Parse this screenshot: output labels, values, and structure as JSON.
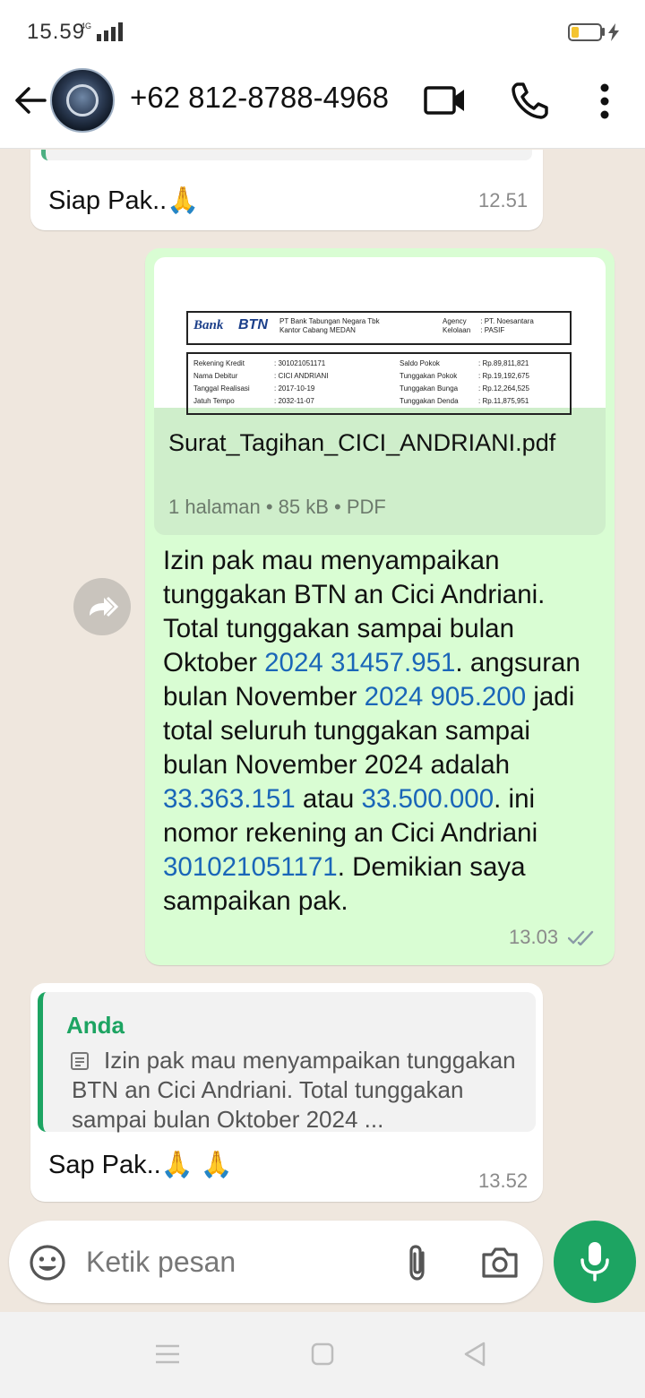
{
  "status_bar": {
    "time": "15.59",
    "network": "4G",
    "battery_level": 0.25,
    "charging": true
  },
  "header": {
    "contact": "+62 812-8788-4968",
    "icons": [
      "back-arrow-icon",
      "avatar",
      "video-call-icon",
      "phone-icon",
      "more-vert-icon"
    ]
  },
  "messages": [
    {
      "direction": "incoming",
      "text": "Siap Pak..🙏",
      "time": "12.51"
    },
    {
      "direction": "outgoing",
      "document": {
        "name": "Surat_Tagihan_CICI_ANDRIANI.pdf",
        "meta": "1 halaman • 85 kB • PDF",
        "preview": {
          "bank": "Bank",
          "brand": "BTN",
          "bank_name": "PT Bank Tabungan Negara Tbk",
          "branch": "Kantor Cabang MEDAN",
          "agency_label": "Agency",
          "agency_value": ": PT. Noesantara",
          "kelolaan_label": "Kelolaan",
          "kelolaan_value": ": PASIF",
          "rows_left": [
            [
              "Rekening Kredit",
              ": 301021051171"
            ],
            [
              "Nama Debitur",
              ": CICI ANDRIANI"
            ],
            [
              "Tanggal Realisasi",
              ": 2017-10-19"
            ],
            [
              "Jatuh Tempo",
              ": 2032-11-07"
            ]
          ],
          "rows_right": [
            [
              "Saldo Pokok",
              ": Rp.89,811,821"
            ],
            [
              "Tunggakan Pokok",
              ": Rp.19,192,675"
            ],
            [
              "Tunggakan Bunga",
              ": Rp.12,264,525"
            ],
            [
              "Tunggakan Denda",
              ": Rp.11,875,951"
            ]
          ]
        }
      },
      "text_parts": [
        {
          "t": "Izin pak mau menyampaikan tunggakan BTN an Cici Andriani. Total tunggakan sampai bulan Oktober ",
          "link": false
        },
        {
          "t": "2024 31457.951",
          "link": true
        },
        {
          "t": ". angsuran bulan November ",
          "link": false
        },
        {
          "t": "2024 905.200",
          "link": true
        },
        {
          "t": " jadi total seluruh tunggakan sampai bulan November 2024 adalah ",
          "link": false
        },
        {
          "t": "33.363.151",
          "link": true
        },
        {
          "t": " atau ",
          "link": false
        },
        {
          "t": "33.500.000",
          "link": true
        },
        {
          "t": ". ini nomor rekening an Cici Andriani ",
          "link": false
        },
        {
          "t": "301021051171",
          "link": true
        },
        {
          "t": ". Demikian saya sampaikan pak.",
          "link": false
        }
      ],
      "time": "13.03",
      "status": "read-double-tick"
    },
    {
      "direction": "incoming",
      "reply_to": {
        "author": "Anda",
        "text": "Izin pak mau menyampaikan tunggakan BTN an Cici Andriani. Total tunggakan sampai bulan Oktober 2024 ..."
      },
      "text": "Sap Pak..🙏 🙏",
      "time": "13.52"
    }
  ],
  "composer": {
    "placeholder": "Ketik pesan",
    "icons": [
      "emoji-icon",
      "attach-icon",
      "camera-icon",
      "mic-icon"
    ]
  },
  "colors": {
    "outgoing_bubble": "#d9fdd3",
    "incoming_bubble": "#ffffff",
    "accent_green": "#1da462",
    "link_blue": "#1a66b8",
    "chat_background": "#efe7de"
  }
}
